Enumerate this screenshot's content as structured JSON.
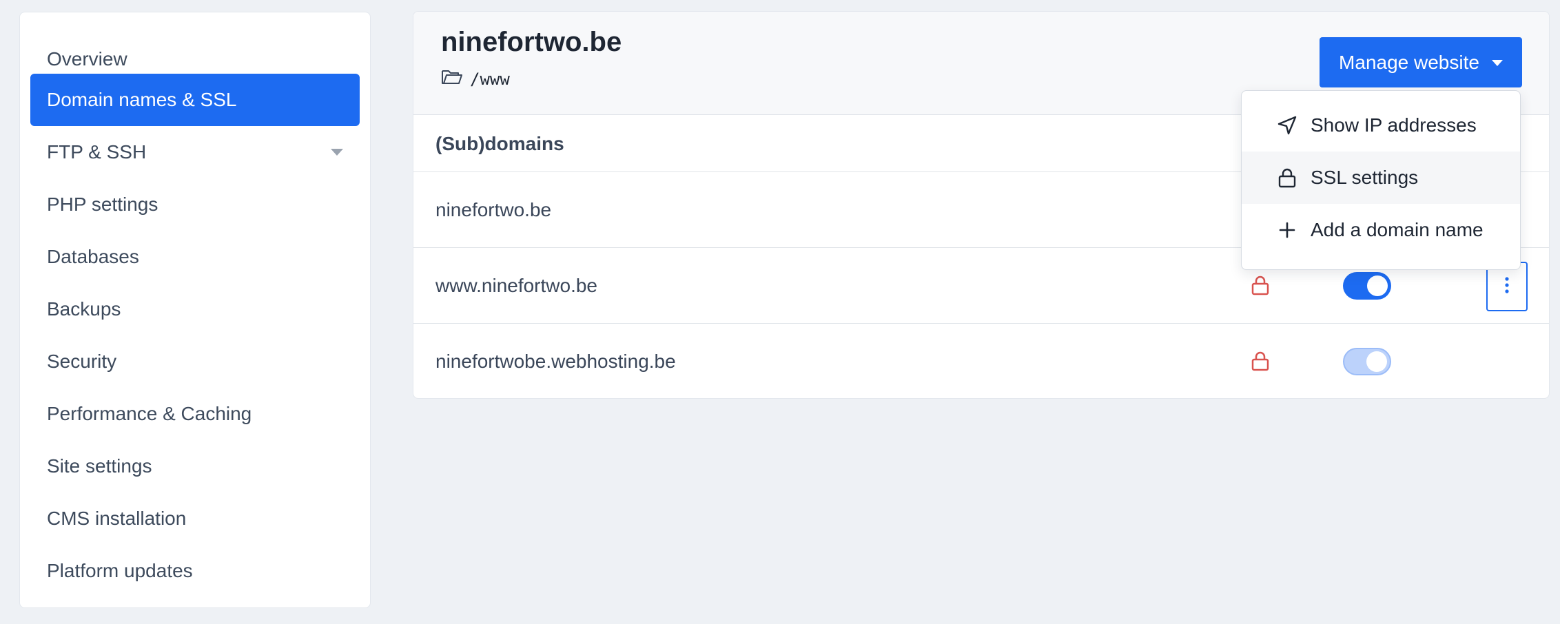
{
  "sidebar": {
    "items": [
      {
        "label": "Overview"
      },
      {
        "label": "Domain names & SSL"
      },
      {
        "label": "FTP & SSH"
      },
      {
        "label": "PHP settings"
      },
      {
        "label": "Databases"
      },
      {
        "label": "Backups"
      },
      {
        "label": "Security"
      },
      {
        "label": "Performance & Caching"
      },
      {
        "label": "Site settings"
      },
      {
        "label": "CMS installation"
      },
      {
        "label": "Platform updates"
      }
    ],
    "active_item": "Domain names & SSL"
  },
  "header": {
    "title": "ninefortwo.be",
    "path": "/www",
    "manage_button_label": "Manage website"
  },
  "table": {
    "header_label": "(Sub)domains",
    "rows": [
      {
        "domain": "ninefortwo.be"
      },
      {
        "domain": "www.ninefortwo.be",
        "ssl_icon": "lock-icon",
        "toggle": "on"
      },
      {
        "domain": "ninefortwobe.webhosting.be",
        "ssl_icon": "lock-icon",
        "toggle": "on-disabled"
      }
    ]
  },
  "dropdown": {
    "items": [
      {
        "label": "Show IP addresses",
        "icon": "navigation-arrow-icon"
      },
      {
        "label": "SSL settings",
        "icon": "lock-icon"
      },
      {
        "label": "Add a domain name",
        "icon": "plus-icon"
      }
    ]
  },
  "colors": {
    "accent": "#1d6bf1",
    "lock_red": "#d9534f",
    "background": "#eef1f5"
  }
}
